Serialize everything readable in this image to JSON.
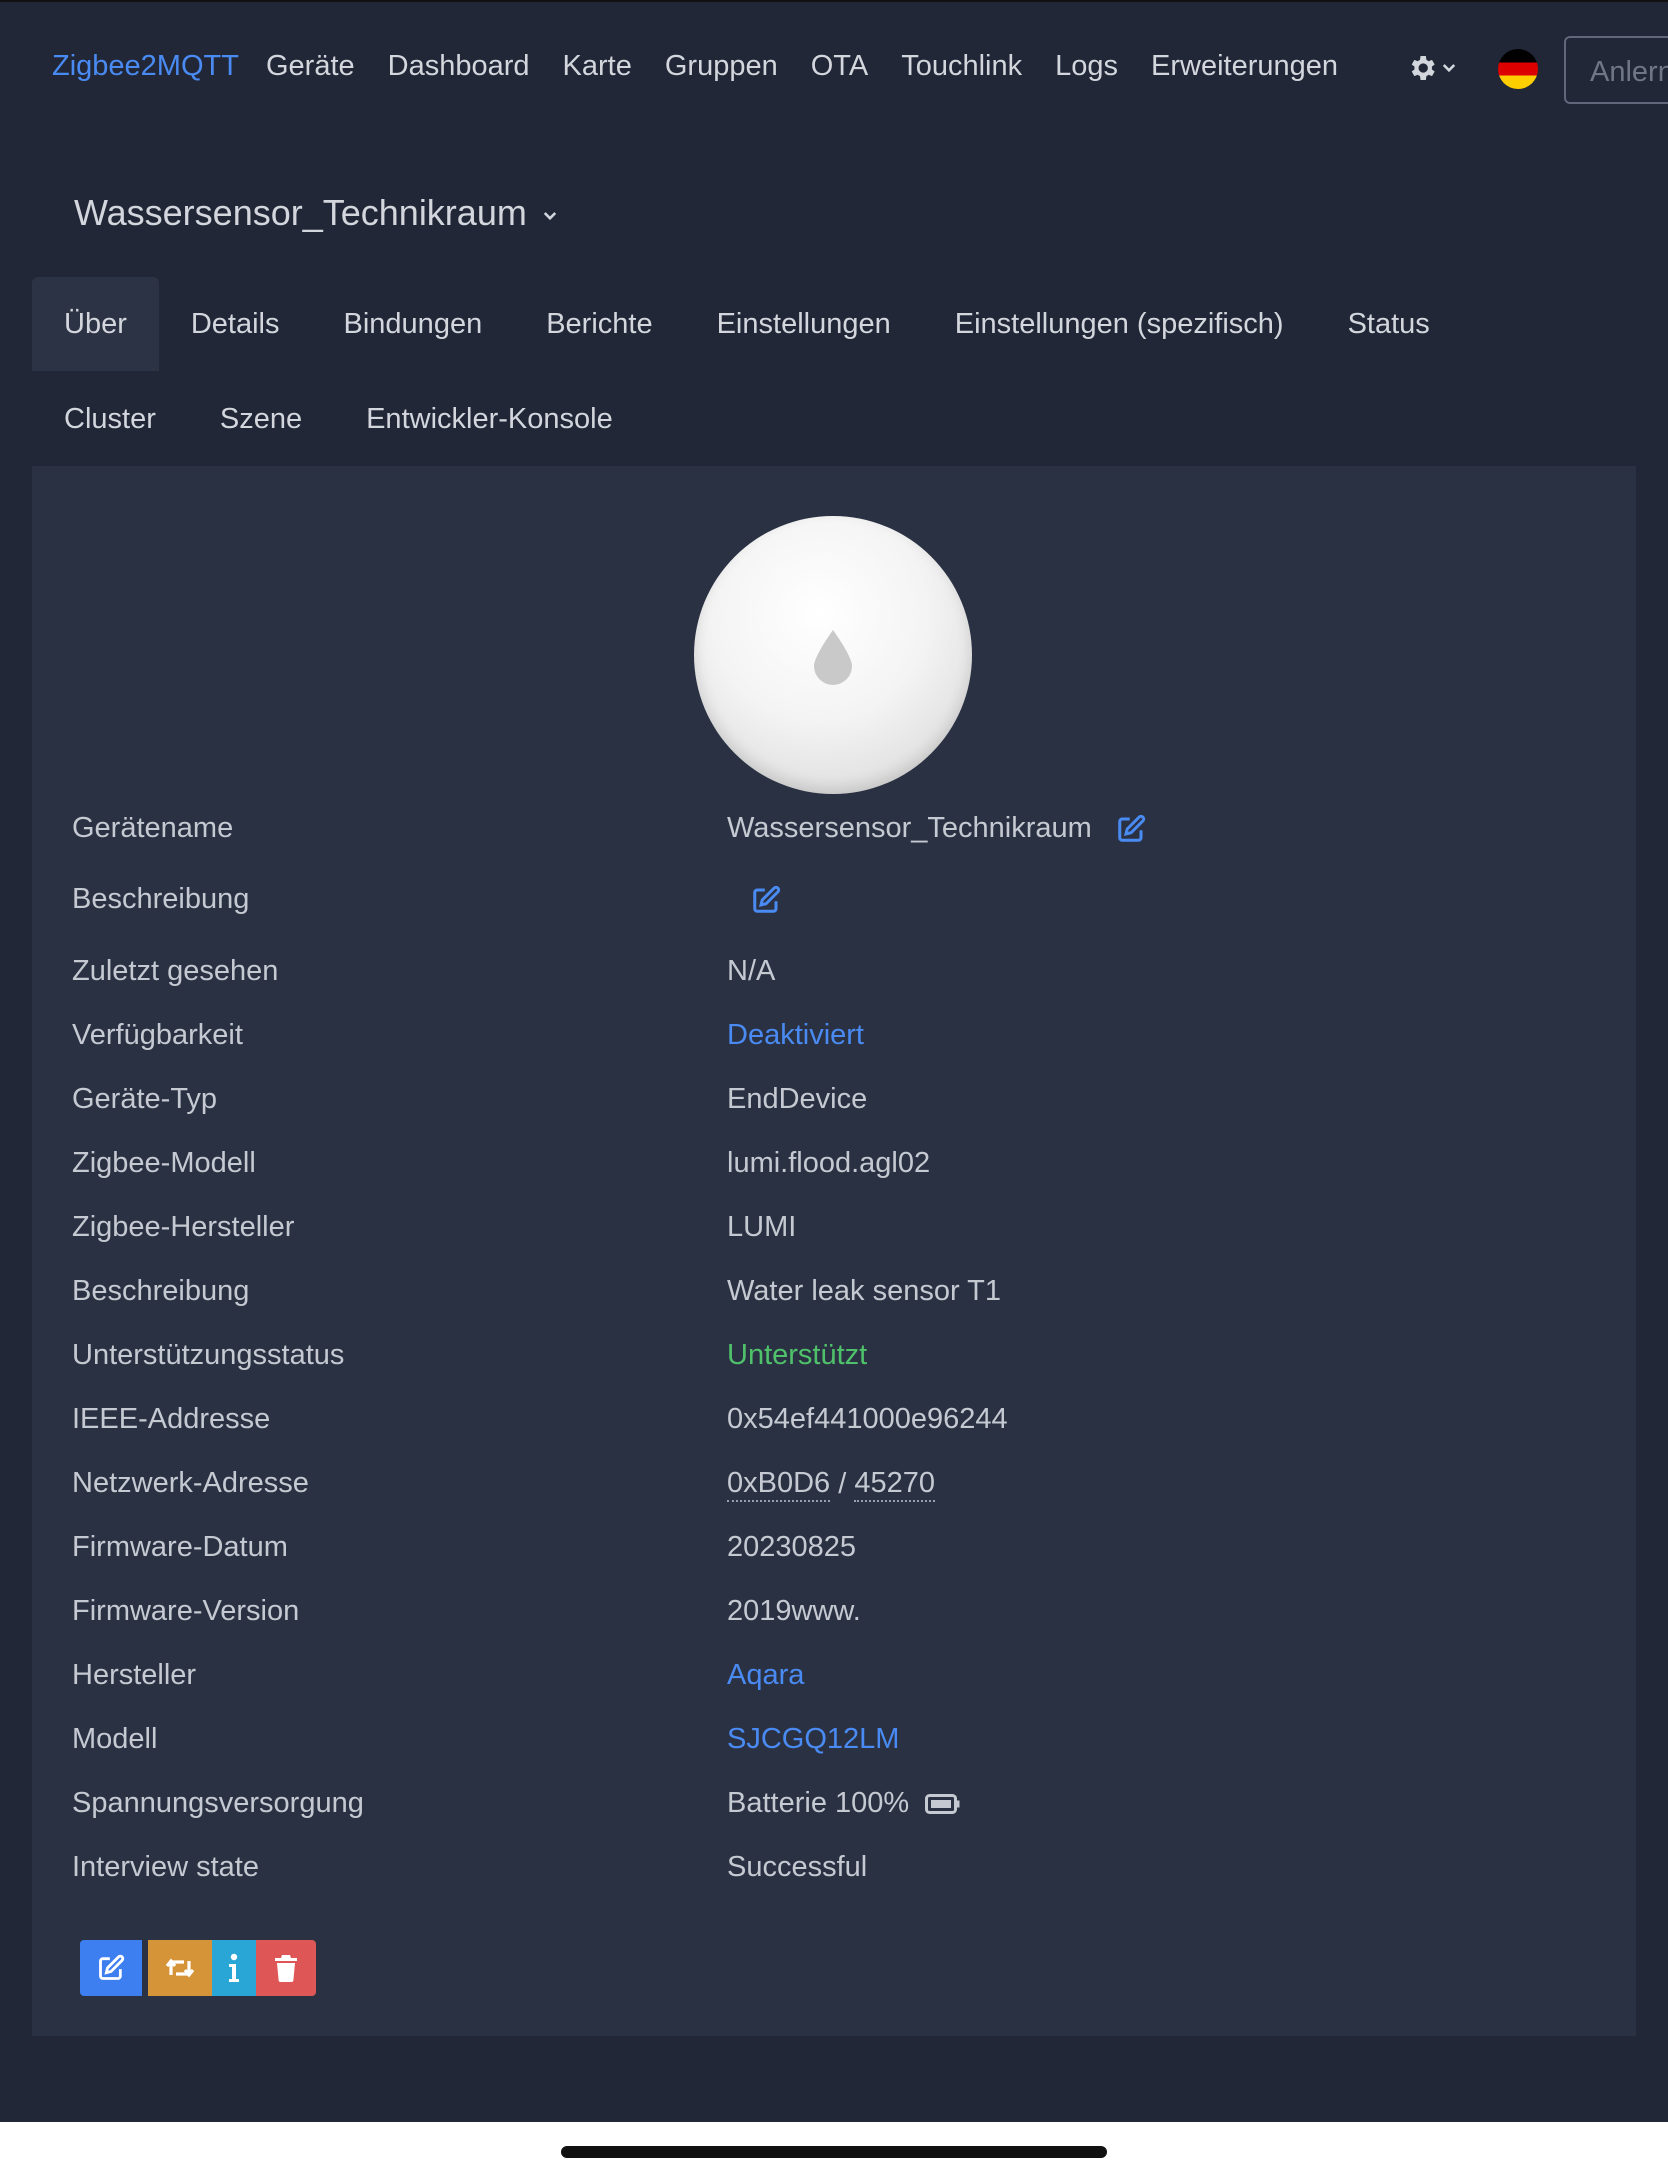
{
  "navbar": {
    "brand": "Zigbee2MQTT",
    "items": [
      "Geräte",
      "Dashboard",
      "Karte",
      "Gruppen",
      "OTA",
      "Touchlink",
      "Logs",
      "Erweiterungen"
    ],
    "settings_icon": "gear-icon",
    "language_flag": "german-flag-icon",
    "login_placeholder": "Anlern"
  },
  "device": {
    "title": "Wassersensor_Technikraum"
  },
  "tabs": {
    "row1": [
      "Über",
      "Details",
      "Bindungen",
      "Berichte",
      "Einstellungen",
      "Einstellungen (spezifisch)",
      "Status"
    ],
    "row2": [
      "Cluster",
      "Szene",
      "Entwickler-Konsole"
    ],
    "active": "Über"
  },
  "info": {
    "geraetename": {
      "label": "Gerätename",
      "value": "Wassersensor_Technikraum"
    },
    "beschreibung": {
      "label": "Beschreibung",
      "value": ""
    },
    "zuletzt": {
      "label": "Zuletzt gesehen",
      "value": "N/A"
    },
    "verfuegbarkeit": {
      "label": "Verfügbarkeit",
      "value": "Deaktiviert"
    },
    "typ": {
      "label": "Geräte-Typ",
      "value": "EndDevice"
    },
    "modell_zb": {
      "label": "Zigbee-Modell",
      "value": "lumi.flood.agl02"
    },
    "hersteller_zb": {
      "label": "Zigbee-Hersteller",
      "value": "LUMI"
    },
    "beschreibung2": {
      "label": "Beschreibung",
      "value": "Water leak sensor T1"
    },
    "support": {
      "label": "Unterstützungsstatus",
      "value": "Unterstützt"
    },
    "ieee": {
      "label": "IEEE-Addresse",
      "value": "0x54ef441000e96244"
    },
    "netzwerk": {
      "label": "Netzwerk-Adresse",
      "hex": "0xB0D6",
      "sep": " / ",
      "dec": "45270"
    },
    "fw_datum": {
      "label": "Firmware-Datum",
      "value": "20230825"
    },
    "fw_version": {
      "label": "Firmware-Version",
      "value": "2019www."
    },
    "hersteller": {
      "label": "Hersteller",
      "value": "Aqara"
    },
    "modell": {
      "label": "Modell",
      "value": "SJCGQ12LM"
    },
    "spannung": {
      "label": "Spannungsversorgung",
      "value": "Batterie 100%"
    },
    "interview": {
      "label": "Interview state",
      "value": "Successful"
    }
  },
  "colors": {
    "background": "#212737",
    "card": "#2a3143",
    "link": "#4a8bf3",
    "success": "#4fc16a",
    "btn_edit": "#3d7ff0",
    "btn_rename": "#d59438",
    "btn_info": "#2aa6d6",
    "btn_delete": "#df5656"
  }
}
